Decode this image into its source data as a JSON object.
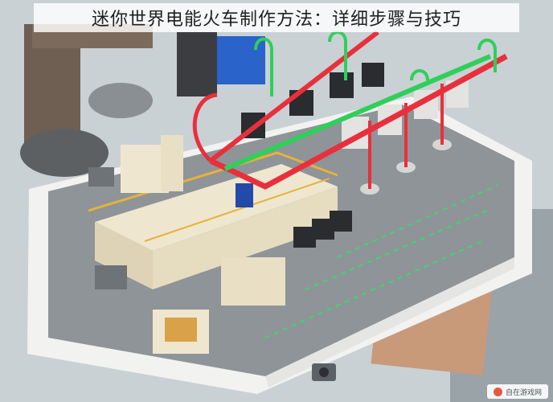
{
  "caption": {
    "title": "迷你世界电能火车制作方法：详细步骤与技巧"
  },
  "watermark": {
    "icon": "site-logo-icon",
    "text": "自在游戏网"
  },
  "colors": {
    "pipe_green": "#2fcf5a",
    "pipe_red": "#e8303c",
    "platform_white": "#f2f2f0",
    "board_gray": "#8f9498",
    "model_cream": "#efe6cf",
    "railing_yellow": "#e6b23a",
    "machine_dark": "#2a2c30"
  }
}
